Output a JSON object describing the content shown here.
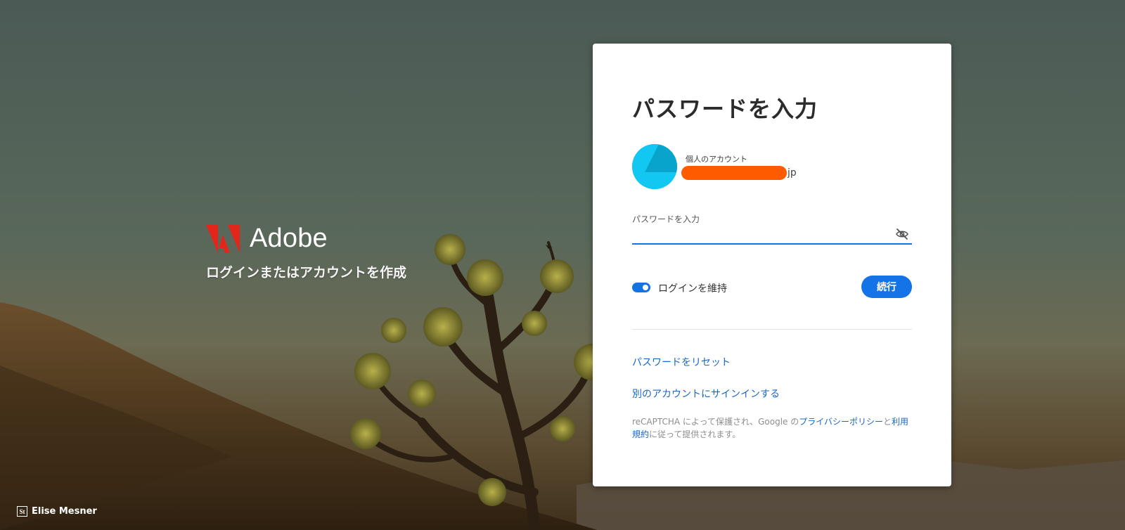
{
  "brand": {
    "name": "Adobe",
    "tagline": "ログインまたはアカウントを作成",
    "logo_color": "#e3261c"
  },
  "card": {
    "title": "パスワードを入力",
    "account": {
      "label": "個人のアカウント",
      "email_suffix": "jp",
      "avatar_color": "#12c8f2",
      "redaction_color": "#fe5a00"
    },
    "password": {
      "label": "パスワードを入力",
      "value": "",
      "visibility_icon": "eye-off-icon"
    },
    "keep_signed_in": {
      "label": "ログインを維持",
      "enabled": true
    },
    "continue_label": "続行",
    "links": {
      "reset_password": "パスワードをリセット",
      "other_account": "別のアカウントにサインインする"
    },
    "recaptcha": {
      "prefix": "reCAPTCHA によって保護され、Google の",
      "privacy_link": "プライバシーポリシー",
      "and": "と",
      "terms_link": "利用規約",
      "suffix": "に従って提供されます。"
    },
    "accent_color": "#1473e6"
  },
  "photo_credit": {
    "icon": "St",
    "name": "Elise Mesner"
  }
}
